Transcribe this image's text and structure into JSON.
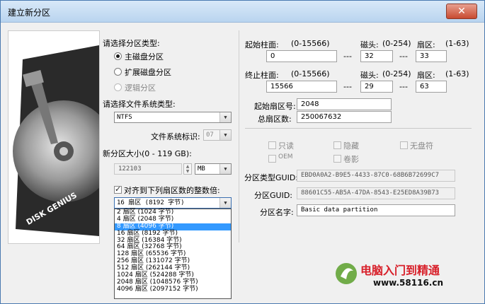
{
  "window": {
    "title": "建立新分区",
    "close_glyph": "✕"
  },
  "side_image": {
    "brand_text": "DISK GENIUS"
  },
  "partition_type": {
    "label": "请选择分区类型:",
    "options": [
      {
        "label": "主磁盘分区",
        "selected": true,
        "disabled": false
      },
      {
        "label": "扩展磁盘分区",
        "selected": false,
        "disabled": false
      },
      {
        "label": "逻辑分区",
        "selected": false,
        "disabled": true
      }
    ]
  },
  "filesystem": {
    "label": "请选择文件系统类型:",
    "value": "NTFS",
    "id_label": "文件系统标识:",
    "id_value": "07"
  },
  "size": {
    "label": "新分区大小(0 - 119 GB):",
    "value": "122103",
    "unit": "MB"
  },
  "align": {
    "checkbox_label": "对齐到下列扇区数的整数倍:",
    "checked": true,
    "value": "16 扇区 (8192 字节)",
    "options": [
      "2 扇区 (1024 字节)",
      "4 扇区 (2048 字节)",
      "8 扇区 (4096 字节)",
      "16 扇区 (8192 字节)",
      "32 扇区 (16384 字节)",
      "64 扇区 (32768 字节)",
      "128 扇区 (65536 字节)",
      "256 扇区 (131072 字节)",
      "512 扇区 (262144 字节)",
      "1024 扇区 (524288 字节)",
      "2048 扇区 (1048576 字节)",
      "4096 扇区 (2097152 字节)"
    ],
    "selected_index": 2
  },
  "start": {
    "cyl_label": "起始柱面:",
    "cyl_range": "(0-15566)",
    "cyl_value": "0",
    "head_label": "磁头:",
    "head_range": "(0-254)",
    "head_value": "32",
    "sec_label": "扇区:",
    "sec_range": "(1-63)",
    "sec_value": "33",
    "dash": "---"
  },
  "end": {
    "cyl_label": "终止柱面:",
    "cyl_range": "(0-15566)",
    "cyl_value": "15566",
    "head_label": "磁头:",
    "head_range": "(0-254)",
    "head_value": "29",
    "sec_label": "扇区:",
    "sec_range": "(1-63)",
    "sec_value": "63",
    "dash": "---"
  },
  "sectors": {
    "start_label": "起始扇区号:",
    "start_value": "2048",
    "total_label": "总扇区数:",
    "total_value": "250067632"
  },
  "attributes": {
    "readonly": "只读",
    "hidden": "隐藏",
    "no_drive_letter": "无盘符",
    "oem": "OEM",
    "shadow": "卷影"
  },
  "guids": {
    "type_label": "分区类型GUID:",
    "type_value": "EBD0A0A2-B9E5-4433-87C0-68B6B72699C7",
    "part_label": "分区GUID:",
    "part_value": "88601C55-AB5A-47DA-8543-E25ED8A39B73",
    "name_label": "分区名字:",
    "name_value": "Basic data partition"
  },
  "watermark": {
    "text": "电脑入门到精通",
    "url": "www.58116.cn"
  },
  "colors": {
    "selection": "#3399ff",
    "watermark_red": "#d8202a",
    "watermark_green": "#5aa02c"
  }
}
